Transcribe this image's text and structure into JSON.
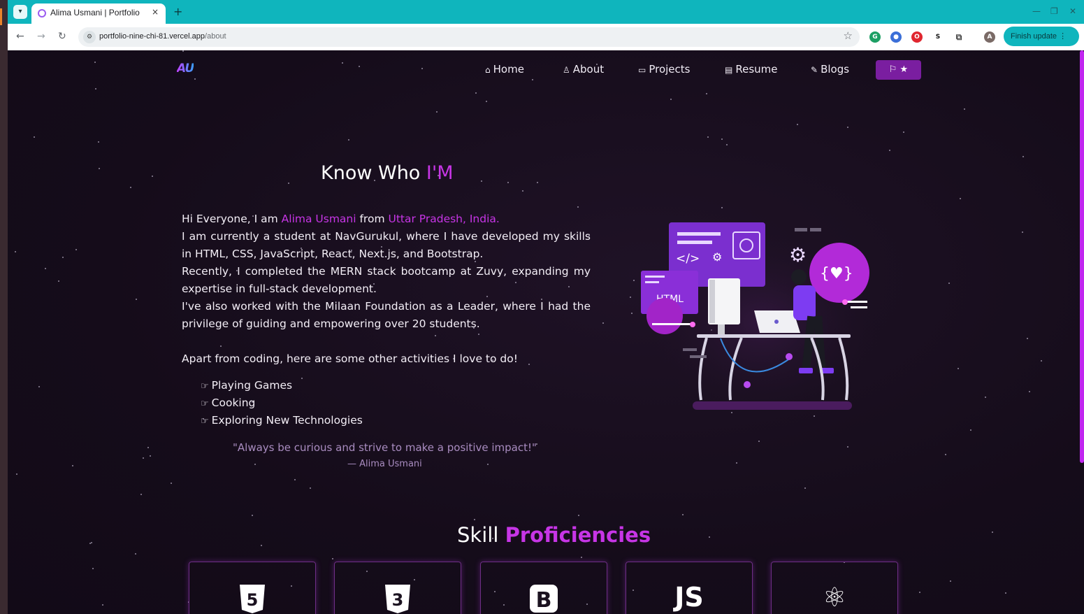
{
  "browser": {
    "tab_title": "Alima Usmani | Portfolio",
    "url_host": "portfolio-nine-chi-81.vercel.app",
    "url_path": "/about",
    "finish_update_label": "Finish update",
    "new_tab_symbol": "+",
    "tab_close_symbol": "×"
  },
  "nav": {
    "items": [
      {
        "label": "Home",
        "icon": "home-icon"
      },
      {
        "label": "About",
        "icon": "user-icon"
      },
      {
        "label": "Projects",
        "icon": "projects-icon"
      },
      {
        "label": "Resume",
        "icon": "document-icon"
      },
      {
        "label": "Blogs",
        "icon": "blogs-icon"
      }
    ],
    "toggle_symbol": "⚐ ★"
  },
  "about": {
    "heading_prefix": "Know Who ",
    "heading_accent": "I'M",
    "intro_prefix": "Hi Everyone, I am ",
    "name": "Alima Usmani",
    "intro_mid": " from ",
    "location": "Uttar Pradesh, India.",
    "line_2": "I am currently a student at NavGurukul, where I have developed my skills in HTML, CSS, JavaScript, React, Next.js, and Bootstrap.",
    "line_3": "Recently, I completed the MERN stack bootcamp at Zuvy, expanding my expertise in full-stack development.",
    "line_4": "I've also worked with the Milaan Foundation as a Leader, where I had the privilege of guiding and empowering over 20 students.",
    "activities_intro": "Apart from coding, here are some other activities I love to do!",
    "activities": [
      "Playing Games",
      "Cooking",
      "Exploring New Technologies"
    ],
    "quote": "\"Always be curious and strive to make a positive impact!\"",
    "quote_author": "— Alima Usmani"
  },
  "skills": {
    "heading_prefix": "Skill ",
    "heading_accent": "Proficiencies",
    "cards": [
      {
        "name": "html5-icon",
        "glyph": "5"
      },
      {
        "name": "css3-icon",
        "glyph": "3"
      },
      {
        "name": "bootstrap-icon",
        "glyph": "B"
      },
      {
        "name": "javascript-icon",
        "glyph": "JS"
      },
      {
        "name": "react-icon",
        "glyph": "⚛"
      }
    ]
  },
  "illustration": {
    "code_tag": "</>",
    "html_label": "HTML",
    "braces_heart": "{♥}"
  },
  "colors": {
    "accent": "#c735e6",
    "chrome": "#0fb5bd",
    "background": "#150c1a"
  }
}
